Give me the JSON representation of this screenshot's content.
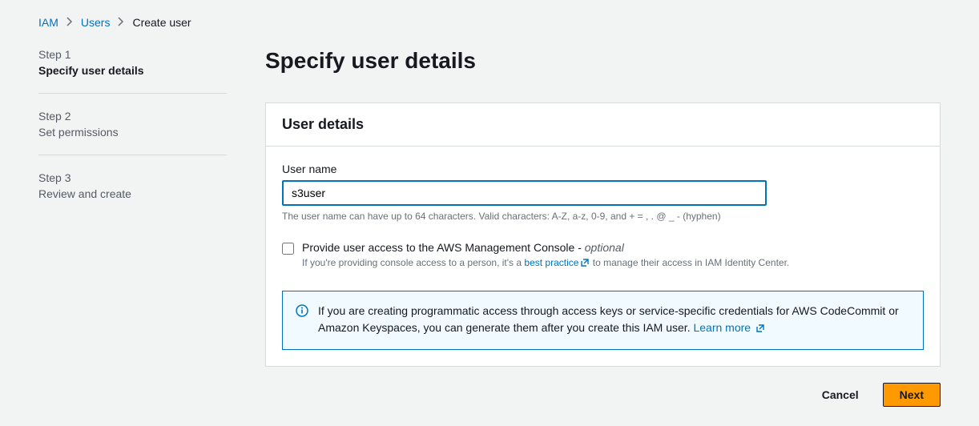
{
  "breadcrumb": {
    "root": "IAM",
    "users": "Users",
    "current": "Create user"
  },
  "steps": [
    {
      "num": "Step 1",
      "title": "Specify user details"
    },
    {
      "num": "Step 2",
      "title": "Set permissions"
    },
    {
      "num": "Step 3",
      "title": "Review and create"
    }
  ],
  "page_title": "Specify user details",
  "panel": {
    "header": "User details",
    "username_label": "User name",
    "username_value": "s3user",
    "username_hint": "The user name can have up to 64 characters. Valid characters: A-Z, a-z, 0-9, and + = , . @ _ - (hyphen)",
    "checkbox_label_main": "Provide user access to the AWS Management Console - ",
    "checkbox_label_optional": "optional",
    "checkbox_desc_pre": "If you're providing console access to a person, it's a ",
    "checkbox_desc_link": "best practice",
    "checkbox_desc_post": " to manage their access in IAM Identity Center.",
    "info_text": "If you are creating programmatic access through access keys or service-specific credentials for AWS CodeCommit or Amazon Keyspaces, you can generate them after you create this IAM user. ",
    "info_link": "Learn more"
  },
  "actions": {
    "cancel": "Cancel",
    "next": "Next"
  }
}
